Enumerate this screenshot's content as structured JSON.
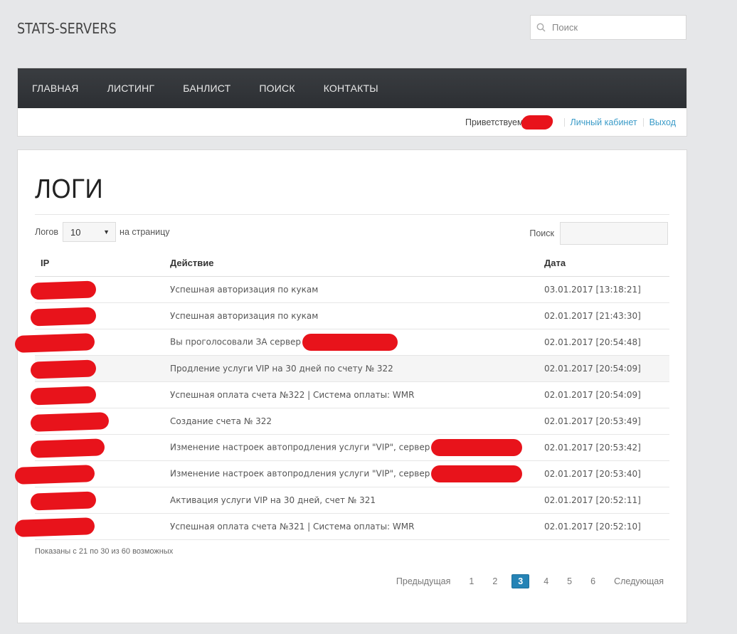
{
  "site": {
    "title": "STATS-SERVERS"
  },
  "search": {
    "placeholder": "Поиск"
  },
  "nav": [
    "ГЛАВНАЯ",
    "ЛИСТИНГ",
    "БАНЛИСТ",
    "ПОИСК",
    "КОНТАКТЫ"
  ],
  "user": {
    "greeting": "Приветствуем",
    "cabinet": "Личный кабинет",
    "logout": "Выход"
  },
  "page": {
    "title": "ЛОГИ"
  },
  "table_controls": {
    "length_label": "Логов",
    "length_value": "10",
    "length_suffix": "на страницу",
    "filter_label": "Поиск"
  },
  "table": {
    "headers": [
      "IP",
      "Действие",
      "Дата"
    ],
    "rows": [
      {
        "action": "Успешная авторизация по кукам",
        "date": "03.01.2017 [13:18:21]"
      },
      {
        "action": "Успешная авторизация по кукам",
        "date": "02.01.2017 [21:43:30]"
      },
      {
        "action": "Вы проголосовали ЗА сервер",
        "date": "02.01.2017 [20:54:48]"
      },
      {
        "action": "Продление услуги VIP на 30 дней по счету № 322",
        "date": "02.01.2017 [20:54:09]"
      },
      {
        "action": "Успешная оплата счета №322 | Система оплаты: WMR",
        "date": "02.01.2017 [20:54:09]"
      },
      {
        "action": "Создание счета № 322",
        "date": "02.01.2017 [20:53:49]"
      },
      {
        "action": "Изменение настроек автопродления услуги \"VIP\", сервер",
        "date": "02.01.2017 [20:53:42]"
      },
      {
        "action": "Изменение настроек автопродления услуги \"VIP\", сервер",
        "date": "02.01.2017 [20:53:40]"
      },
      {
        "action": "Активация услуги VIP на 30 дней, счет № 321",
        "date": "02.01.2017 [20:52:11]"
      },
      {
        "action": "Успешная оплата счета №321 | Система оплаты: WMR",
        "date": "02.01.2017 [20:52:10]"
      }
    ]
  },
  "info": "Показаны с 21 по 30 из 60 возможных",
  "pager": {
    "prev": "Предыдущая",
    "pages": [
      "1",
      "2",
      "3",
      "4",
      "5",
      "6"
    ],
    "current": "3",
    "next": "Следующая"
  },
  "colors": {
    "accent": "#2583b5",
    "link": "#3a9bc8",
    "nav_bg": "#2f3236",
    "redaction": "#e8131b"
  }
}
